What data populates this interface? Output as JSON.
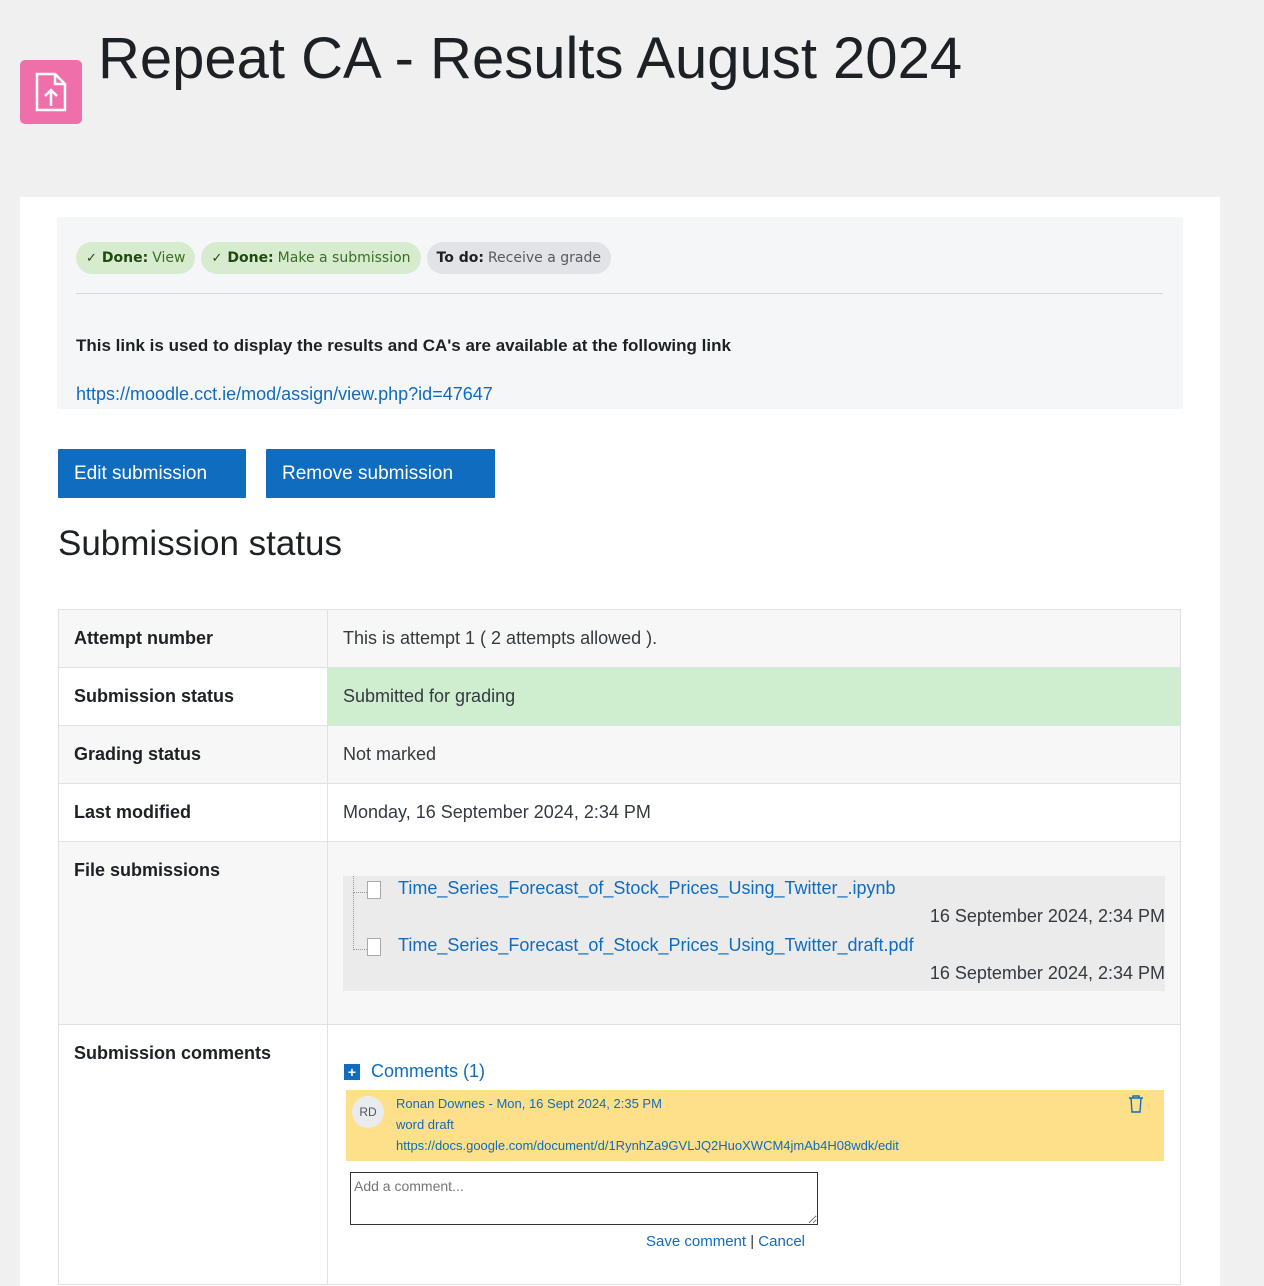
{
  "header": {
    "title": "Repeat CA - Results August 2024",
    "icon": "assignment-upload-icon",
    "icon_color": "#ef6fab"
  },
  "activity_info": {
    "badges": [
      {
        "status": "Done:",
        "label": "View"
      },
      {
        "status": "Done:",
        "label": "Make a submission"
      },
      {
        "status": "To do:",
        "label": "Receive a grade"
      }
    ],
    "intro": "This link is used to display the results and CA's are available at the following link",
    "link": "https://moodle.cct.ie/mod/assign/view.php?id=47647"
  },
  "actions": {
    "edit_label": "Edit submission",
    "remove_label": "Remove submission",
    "accent": "#0f6cbf"
  },
  "submission_status": {
    "title": "Submission status",
    "rows": [
      {
        "label": "Attempt number",
        "value": "This is attempt 1 ( 2 attempts allowed )."
      },
      {
        "label": "Submission status",
        "value": "Submitted for grading"
      },
      {
        "label": "Grading status",
        "value": "Not marked"
      },
      {
        "label": "Last modified",
        "value": "Monday, 16 September 2024, 2:34 PM"
      },
      {
        "label": "File submissions"
      },
      {
        "label": "Submission comments"
      }
    ],
    "files": [
      {
        "name": "Time_Series_Forecast_of_Stock_Prices_Using_Twitter_.ipynb",
        "date": "16 September 2024, 2:34 PM"
      },
      {
        "name": "Time_Series_Forecast_of_Stock_Prices_Using_Twitter_draft.pdf",
        "date": "16 September 2024, 2:34 PM"
      }
    ],
    "comments": {
      "toggle_label": "Comments (1)",
      "items": [
        {
          "initials": "RD",
          "meta": "Ronan Downes - Mon, 16 Sept 2024, 2:35 PM",
          "text": "word draft",
          "url": "https://docs.google.com/document/d/1RynhZa9GVLJQ2HuoXWCM4jmAb4H08wdk/edit"
        }
      ],
      "placeholder": "Add a comment...",
      "save_label": "Save comment",
      "separator": "|",
      "cancel_label": "Cancel"
    }
  }
}
